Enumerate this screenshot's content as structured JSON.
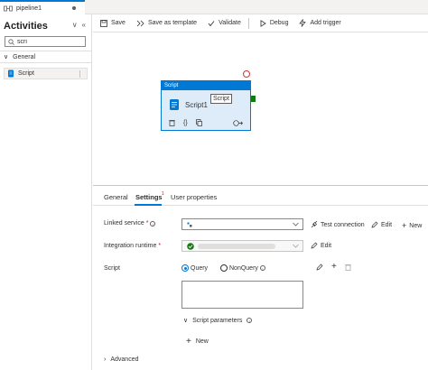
{
  "tab": {
    "title": "pipeline1"
  },
  "activities": {
    "title": "Activities",
    "search_value": "scri",
    "category": "General",
    "items": [
      {
        "label": "Script"
      }
    ]
  },
  "toolbar": {
    "save": "Save",
    "save_template": "Save as template",
    "validate": "Validate",
    "debug": "Debug",
    "add_trigger": "Add trigger"
  },
  "canvas": {
    "node": {
      "type": "Script",
      "name": "Script1",
      "tooltip": "Script"
    }
  },
  "properties": {
    "tabs": [
      "General",
      "Settings",
      "User properties"
    ],
    "active_tab": "Settings",
    "settings_badge": "1",
    "linked_service": {
      "label": "Linked service",
      "required_mark": "*",
      "actions": {
        "test": "Test connection",
        "edit": "Edit",
        "new": "New"
      }
    },
    "integration_runtime": {
      "label": "Integration runtime",
      "required_mark": "*",
      "edit": "Edit"
    },
    "script": {
      "label": "Script",
      "options": [
        "Query",
        "NonQuery"
      ],
      "selected": "Query"
    },
    "script_parameters": {
      "label": "Script parameters",
      "new": "New"
    },
    "advanced": "Advanced"
  },
  "colors": {
    "accent": "#0078d4",
    "success": "#107c10",
    "error": "#d13438"
  }
}
